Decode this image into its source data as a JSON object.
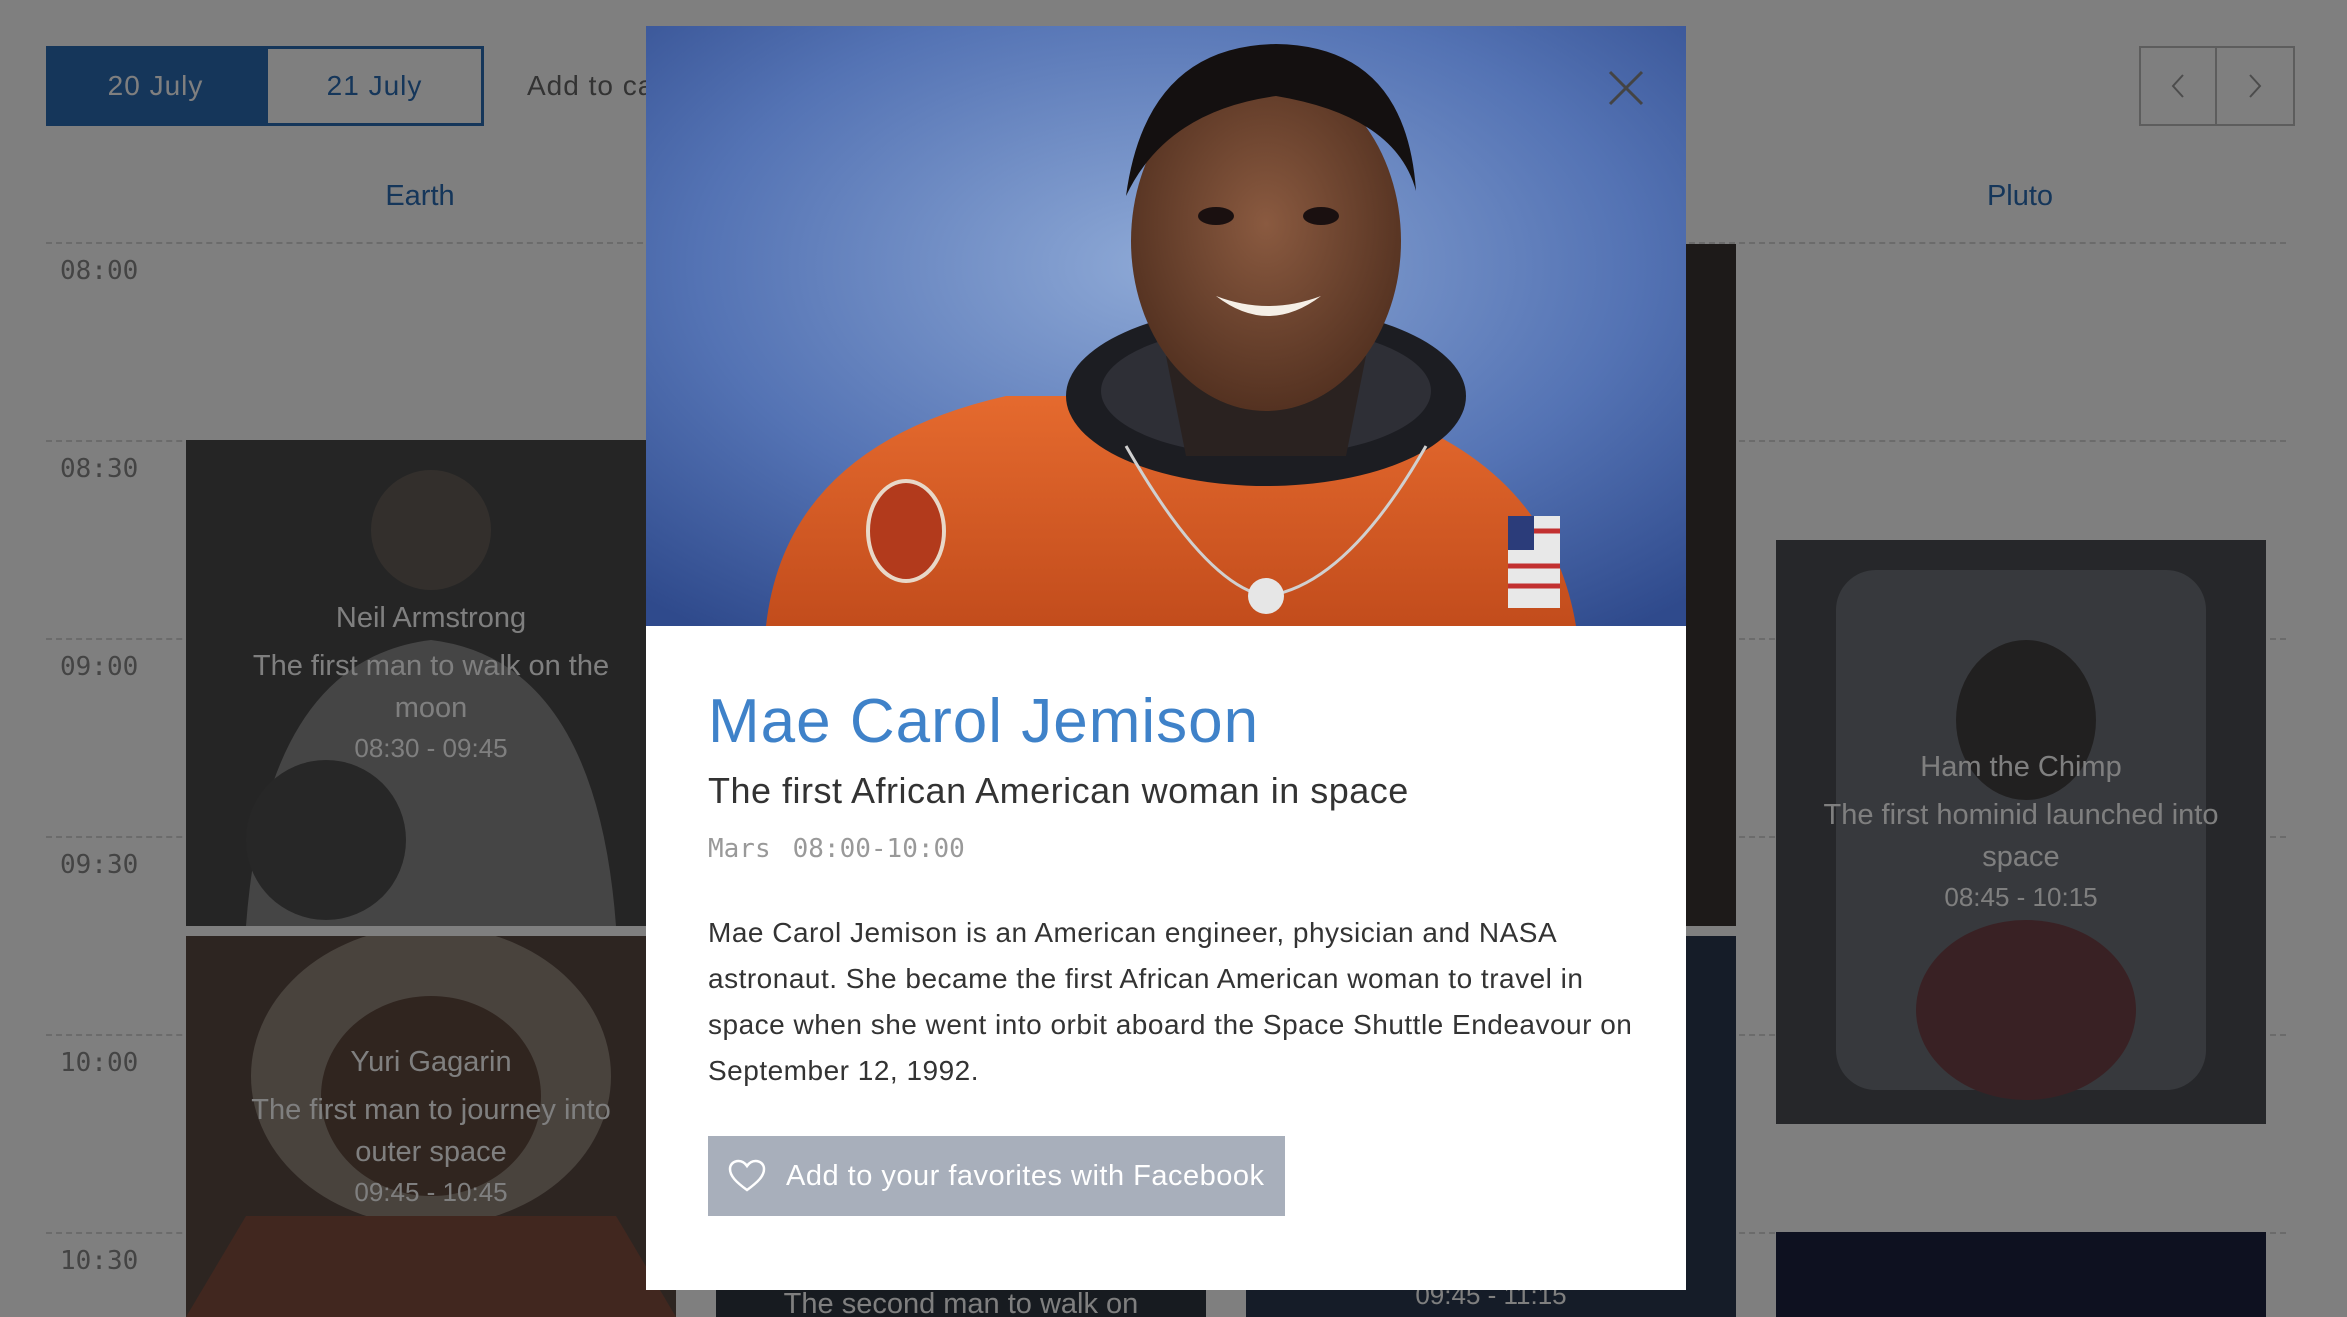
{
  "schedule": {
    "date_tabs": [
      {
        "label": "20 July",
        "active": true
      },
      {
        "label": "21 July",
        "active": false
      }
    ],
    "add_to_calendar": "Add to ca",
    "columns": {
      "earth": "Earth",
      "pluto": "Pluto"
    },
    "times": [
      "08:00",
      "08:30",
      "09:00",
      "09:30",
      "10:00",
      "10:30"
    ],
    "events": {
      "armstrong": {
        "name": "Neil Armstrong",
        "desc": "The first man to walk on the moon",
        "time": "08:30 - 09:45"
      },
      "gagarin": {
        "name": "Yuri Gagarin",
        "desc": "The first man to journey into outer space",
        "time": "09:45 - 10:45"
      },
      "ham": {
        "name": "Ham the Chimp",
        "desc": "The first hominid launched into space",
        "time": "08:45 - 10:15"
      },
      "aldrin_partial": {
        "desc": "The second man to walk on"
      },
      "partial_time": {
        "time": "09:45 - 11:15"
      }
    }
  },
  "modal": {
    "name": "Mae Carol Jemison",
    "subtitle": "The first African American woman in space",
    "location": "Mars",
    "time": "08:00-10:00",
    "description": "Mae Carol Jemison is an American engineer, physician and NASA astronaut. She became the first African American woman to travel in space when she went into orbit aboard the Space Shuttle Endeavour on September 12, 1992.",
    "favorite_button": "Add to your favorites with Facebook"
  },
  "colors": {
    "accent": "#2a6cb5",
    "modal_title": "#3f82c9",
    "button_gray": "#a8afbb",
    "overlay": "rgba(0,0,0,0.5)"
  },
  "icons": [
    "chevron-left-icon",
    "chevron-right-icon",
    "close-icon",
    "heart-icon"
  ]
}
